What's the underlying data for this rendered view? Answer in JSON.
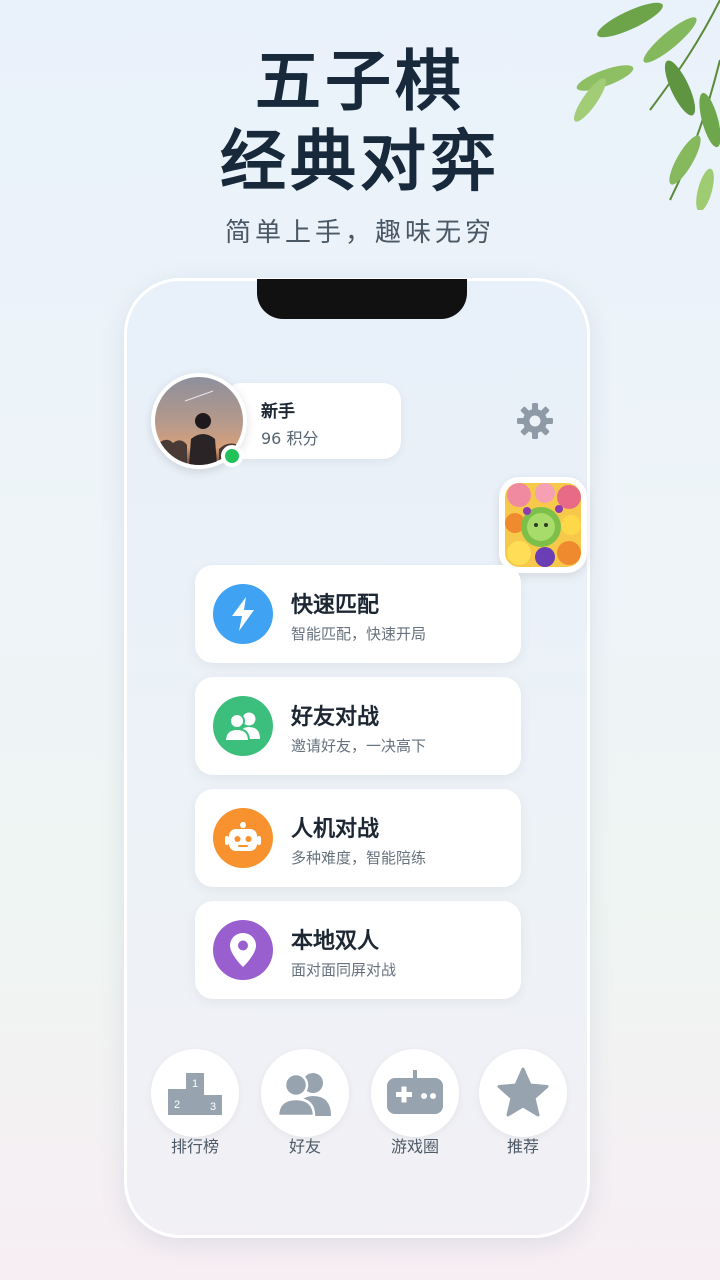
{
  "hero": {
    "title_line1": "五子棋",
    "title_line2": "经典对弈",
    "subtitle": "简单上手，趣味无穷"
  },
  "profile": {
    "name": "新手",
    "score": "96 积分",
    "status_color": "#22c25a"
  },
  "modes": [
    {
      "title": "快速匹配",
      "desc": "智能匹配，快速开局",
      "icon": "lightning-icon",
      "color": "#3fa2f3"
    },
    {
      "title": "好友对战",
      "desc": "邀请好友，一决高下",
      "icon": "friends-icon",
      "color": "#3cbf7d"
    },
    {
      "title": "人机对战",
      "desc": "多种难度，智能陪练",
      "icon": "robot-icon",
      "color": "#f7922f"
    },
    {
      "title": "本地双人",
      "desc": "面对面同屏对战",
      "icon": "location-pin-icon",
      "color": "#9a5fcf"
    }
  ],
  "nav": [
    {
      "label": "排行榜",
      "icon": "podium-icon"
    },
    {
      "label": "好友",
      "icon": "friends-icon"
    },
    {
      "label": "游戏圈",
      "icon": "gamepad-icon"
    },
    {
      "label": "推荐",
      "icon": "star-icon"
    }
  ]
}
